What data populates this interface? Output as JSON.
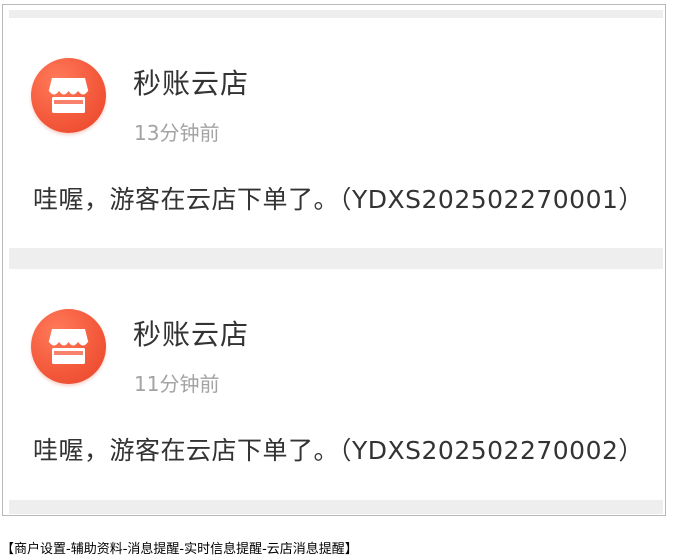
{
  "notifications": [
    {
      "icon": "store-icon",
      "sender": "秒账云店",
      "time": "13分钟前",
      "message": "哇喔，游客在云店下单了。（YDXS202502270001）"
    },
    {
      "icon": "store-icon",
      "sender": "秒账云店",
      "time": "11分钟前",
      "message": "哇喔，游客在云店下单了。（YDXS202502270002）"
    }
  ],
  "caption": "【商户设置-辅助资料-消息提醒-实时信息提醒-云店消息提醒】",
  "colors": {
    "avatar": "#f45a3c",
    "separator": "#eeeeef",
    "title": "#333333",
    "time": "#a3a3a3"
  }
}
